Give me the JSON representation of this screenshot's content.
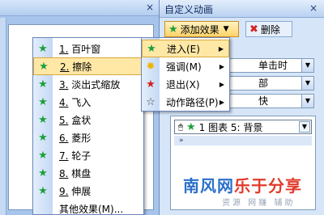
{
  "taskpane": {
    "title": "自定义动画",
    "close_glyph": "×",
    "add_effect_label": "添加效果",
    "add_effect_caret": "▼",
    "delete_label": "删除",
    "selects": [
      {
        "value": "单击时"
      },
      {
        "value": "部"
      },
      {
        "value": "快"
      }
    ],
    "animation_list": {
      "item_label": "1    图表 5: 背景",
      "expand_glyph": "»"
    }
  },
  "workspace": {
    "close_glyph": "×"
  },
  "add_submenu": {
    "items": [
      {
        "label": "进入(E)",
        "icon": "star-green-icon"
      },
      {
        "label": "强调(M)",
        "icon": "star-yellow-icon"
      },
      {
        "label": "退出(X)",
        "icon": "star-red-icon"
      },
      {
        "label": "动作路径(P)",
        "icon": "star-outline-icon"
      }
    ]
  },
  "effects_menu": {
    "items": [
      {
        "num": "1.",
        "label": "百叶窗"
      },
      {
        "num": "2.",
        "label": "擦除"
      },
      {
        "num": "3.",
        "label": "淡出式缩放"
      },
      {
        "num": "4.",
        "label": "飞入"
      },
      {
        "num": "5.",
        "label": "盒状"
      },
      {
        "num": "6.",
        "label": "菱形"
      },
      {
        "num": "7.",
        "label": "轮子"
      },
      {
        "num": "8.",
        "label": "棋盘"
      },
      {
        "num": "9.",
        "label": "伸展"
      },
      {
        "num": "",
        "label": "其他效果(M)..."
      }
    ]
  },
  "watermark": {
    "main_blue": "南风网",
    "main_red": "乐于分享",
    "sub": "资源 网赚 辅助"
  },
  "colors": {
    "accent": "#ffd46a",
    "pane_bg": "#d6e5f8",
    "green_star": "#1aa03a"
  }
}
